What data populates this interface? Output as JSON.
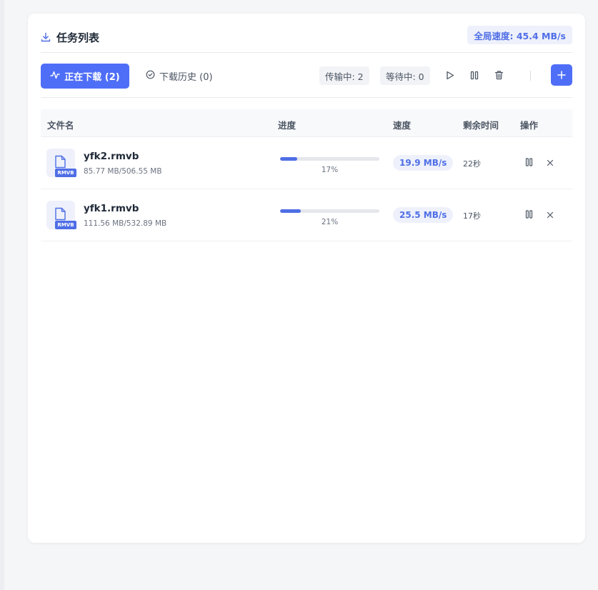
{
  "header": {
    "title": "任务列表",
    "global_speed": "全局速度: 45.4 MB/s"
  },
  "toolbar": {
    "tab_active_label": "正在下载 (2)",
    "tab_history_label": "下载历史 (0)",
    "stat_transferring": "传输中: 2",
    "stat_waiting": "等待中: 0"
  },
  "table": {
    "headers": [
      "文件名",
      "进度",
      "速度",
      "剩余时间",
      "操作"
    ],
    "rows": [
      {
        "name": "yfk2.rmvb",
        "size": "85.77 MB/506.55 MB",
        "badge": "RMVB",
        "progress_text": "17%",
        "progress": 0.17,
        "speed": "19.9 MB/s",
        "remaining": "22秒"
      },
      {
        "name": "yfk1.rmvb",
        "size": "111.56 MB/532.89 MB",
        "badge": "RMVB",
        "progress_text": "21%",
        "progress": 0.21,
        "speed": "25.5 MB/s",
        "remaining": "17秒"
      }
    ]
  },
  "icons": {
    "header": "download-icon",
    "active_tab": "activity-icon",
    "history_tab": "check-circle-icon",
    "start_all": "play-icon",
    "pause_all": "pause-icon",
    "delete_all": "trash-icon",
    "add": "plus-icon",
    "row_pause": "pause-icon",
    "row_cancel": "close-icon"
  },
  "colors": {
    "accent": "#4f6ef7",
    "accent_text": "#4f6ee6",
    "accent_light": "#eef1fb"
  }
}
